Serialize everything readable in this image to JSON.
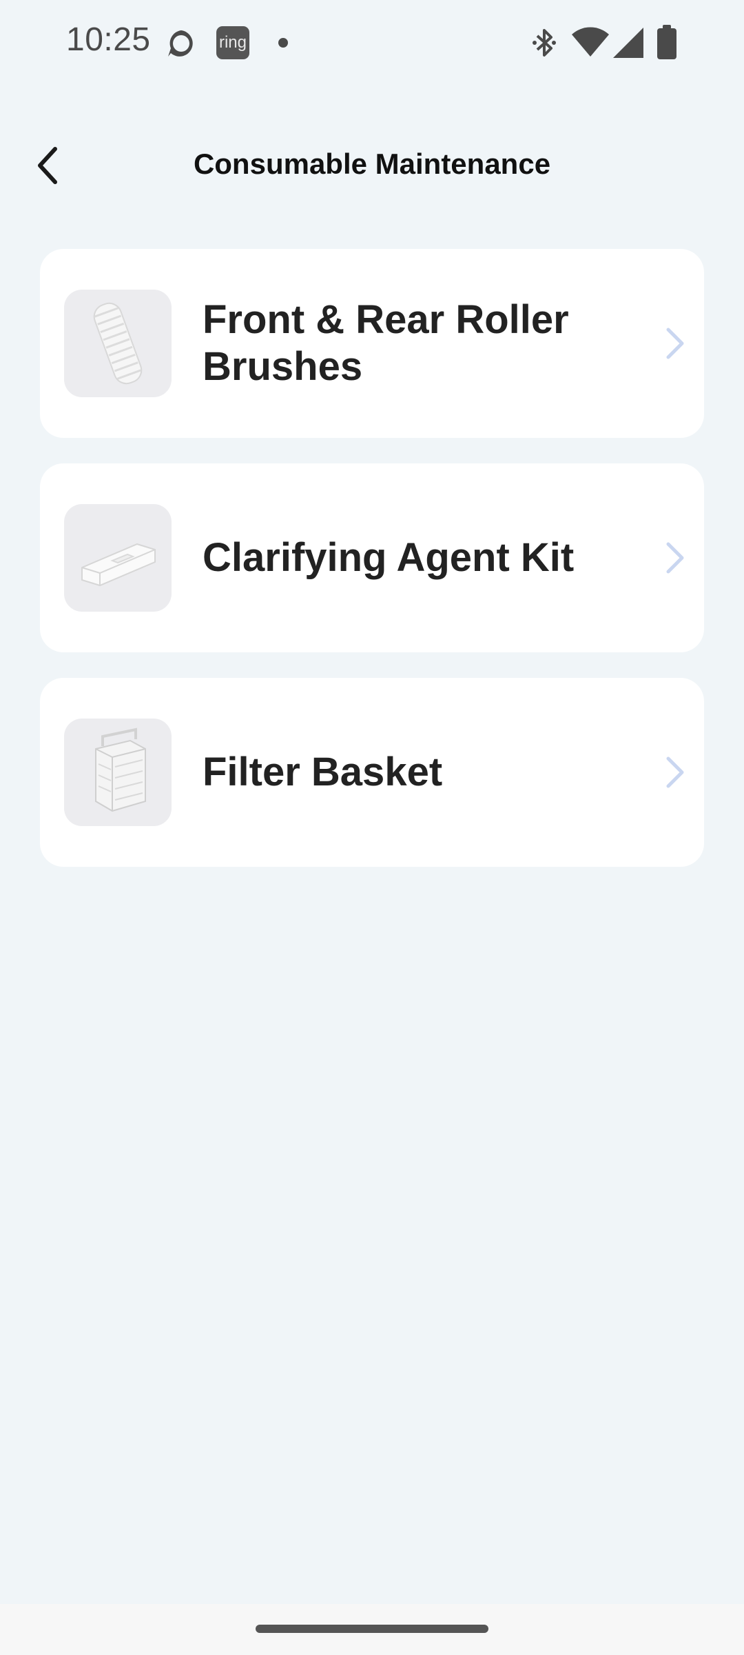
{
  "status_bar": {
    "time": "10:25",
    "notification_icons": [
      "alexa-icon",
      "ring-icon",
      "dot-icon"
    ],
    "ring_label": "ring",
    "system_icons": [
      "bluetooth-icon",
      "wifi-icon",
      "signal-icon",
      "battery-icon"
    ]
  },
  "header": {
    "back_icon": "chevron-left-icon",
    "title": "Consumable Maintenance"
  },
  "items": [
    {
      "label": "Front & Rear Roller Brushes",
      "thumbnail": "roller-brush-image"
    },
    {
      "label": "Clarifying Agent Kit",
      "thumbnail": "clarifying-agent-image"
    },
    {
      "label": "Filter Basket",
      "thumbnail": "filter-basket-image"
    }
  ],
  "colors": {
    "background": "#f0f5f8",
    "card": "#ffffff",
    "chevron": "#c9d6f0"
  }
}
